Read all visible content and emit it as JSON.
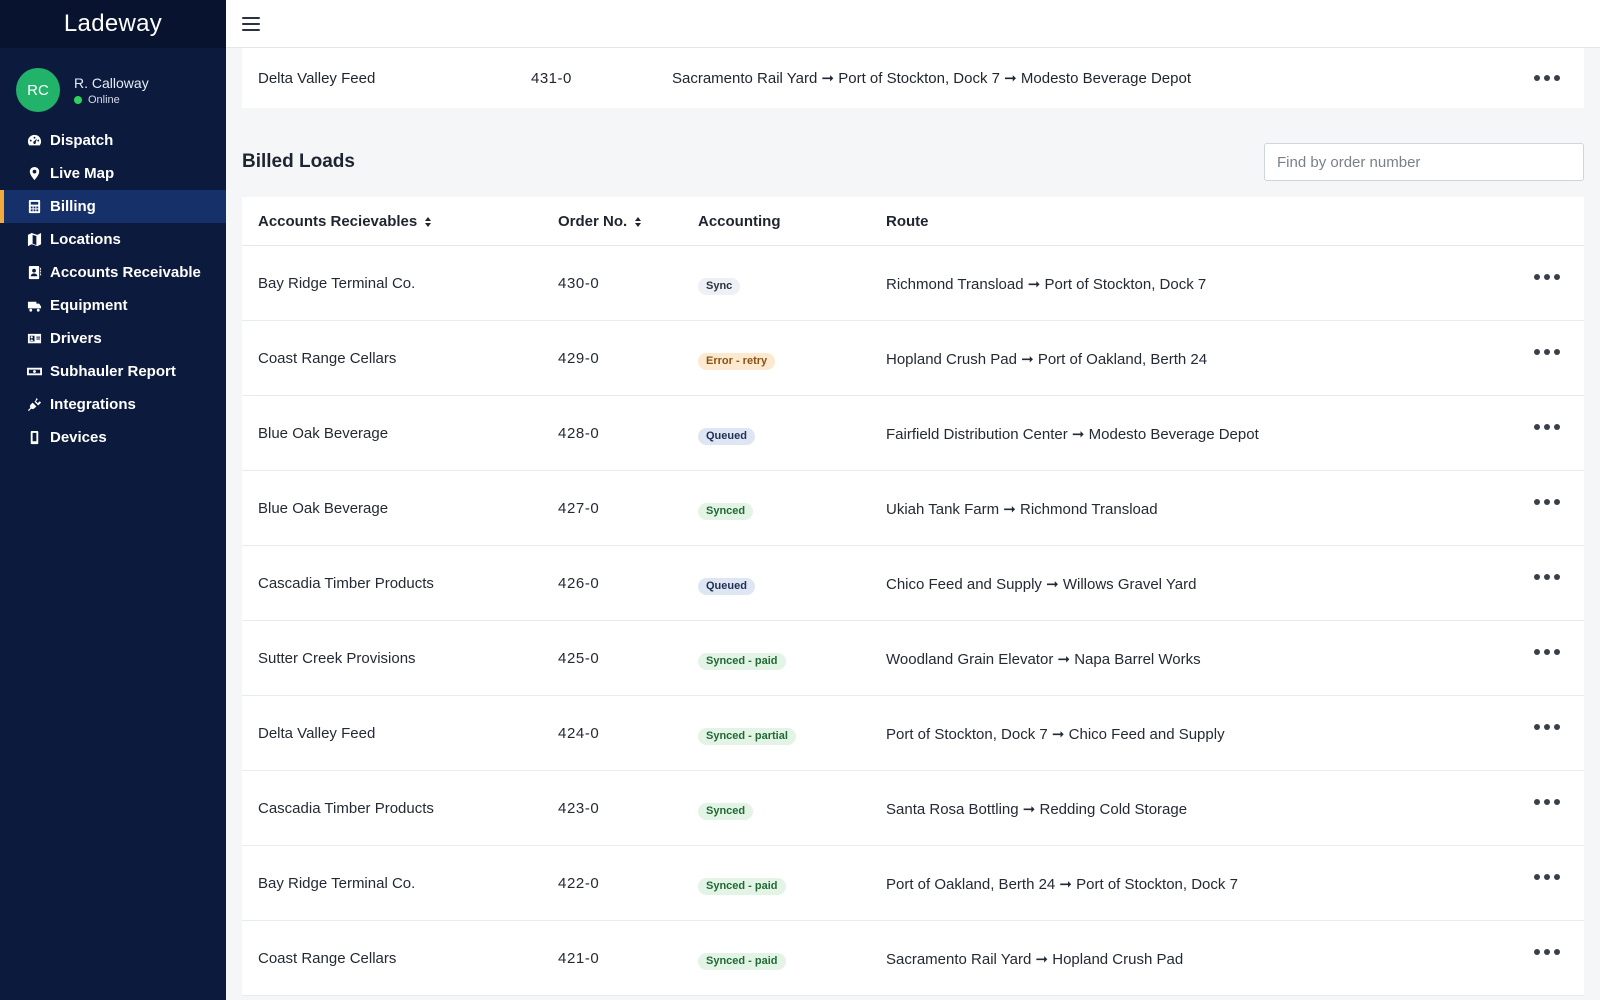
{
  "app": {
    "brand": "Ladeway"
  },
  "user": {
    "initials": "RC",
    "name": "R. Calloway",
    "status": "Online"
  },
  "nav": [
    {
      "label": "Dispatch",
      "icon": "dashboard-gauge-icon",
      "active": false
    },
    {
      "label": "Live Map",
      "icon": "map-pin-icon",
      "active": false
    },
    {
      "label": "Billing",
      "icon": "calculator-icon",
      "active": true
    },
    {
      "label": "Locations",
      "icon": "map-icon",
      "active": false
    },
    {
      "label": "Accounts Receivable",
      "icon": "contact-book-icon",
      "active": false
    },
    {
      "label": "Equipment",
      "icon": "truck-icon",
      "active": false
    },
    {
      "label": "Drivers",
      "icon": "id-card-icon",
      "active": false
    },
    {
      "label": "Subhauler Report",
      "icon": "money-bill-icon",
      "active": false
    },
    {
      "label": "Integrations",
      "icon": "plug-icon",
      "active": false
    },
    {
      "label": "Devices",
      "icon": "mobile-device-icon",
      "active": false
    }
  ],
  "previous_row": {
    "customer": "Delta Valley Feed",
    "order": "431-0",
    "route": "Sacramento Rail Yard ➞ Port of Stockton, Dock 7 ➞ Modesto Beverage Depot"
  },
  "billed": {
    "title": "Billed Loads",
    "search_placeholder": "Find by order number",
    "columns": {
      "customer": "Accounts Recievables",
      "order": "Order No.",
      "accounting": "Accounting",
      "route": "Route"
    },
    "rows": [
      {
        "customer": "Bay Ridge Terminal Co.",
        "order": "430-0",
        "status": "Sync",
        "kind": "sync",
        "route": "Richmond Transload ➞ Port of Stockton, Dock 7"
      },
      {
        "customer": "Coast Range Cellars",
        "order": "429-0",
        "status": "Error - retry",
        "kind": "error",
        "route": "Hopland Crush Pad ➞ Port of Oakland, Berth 24"
      },
      {
        "customer": "Blue Oak Beverage",
        "order": "428-0",
        "status": "Queued",
        "kind": "queued",
        "route": "Fairfield Distribution Center ➞ Modesto Beverage Depot"
      },
      {
        "customer": "Blue Oak Beverage",
        "order": "427-0",
        "status": "Synced",
        "kind": "synced",
        "route": "Ukiah Tank Farm ➞ Richmond Transload"
      },
      {
        "customer": "Cascadia Timber Products",
        "order": "426-0",
        "status": "Queued",
        "kind": "queued",
        "route": "Chico Feed and Supply ➞ Willows Gravel Yard"
      },
      {
        "customer": "Sutter Creek Provisions",
        "order": "425-0",
        "status": "Synced - paid",
        "kind": "synced",
        "route": "Woodland Grain Elevator ➞ Napa Barrel Works"
      },
      {
        "customer": "Delta Valley Feed",
        "order": "424-0",
        "status": "Synced - partial",
        "kind": "synced",
        "route": "Port of Stockton, Dock 7 ➞ Chico Feed and Supply"
      },
      {
        "customer": "Cascadia Timber Products",
        "order": "423-0",
        "status": "Synced",
        "kind": "synced",
        "route": "Santa Rosa Bottling ➞ Redding Cold Storage"
      },
      {
        "customer": "Bay Ridge Terminal Co.",
        "order": "422-0",
        "status": "Synced - paid",
        "kind": "synced",
        "route": "Port of Oakland, Berth 24 ➞ Port of Stockton, Dock 7"
      },
      {
        "customer": "Coast Range Cellars",
        "order": "421-0",
        "status": "Synced - paid",
        "kind": "synced",
        "route": "Sacramento Rail Yard ➞ Hopland Crush Pad"
      }
    ]
  },
  "colors": {
    "sidebar": "#0c1a3d",
    "active_accent": "#f4a93b",
    "avatar": "#21b36a",
    "online": "#2fd15f"
  }
}
